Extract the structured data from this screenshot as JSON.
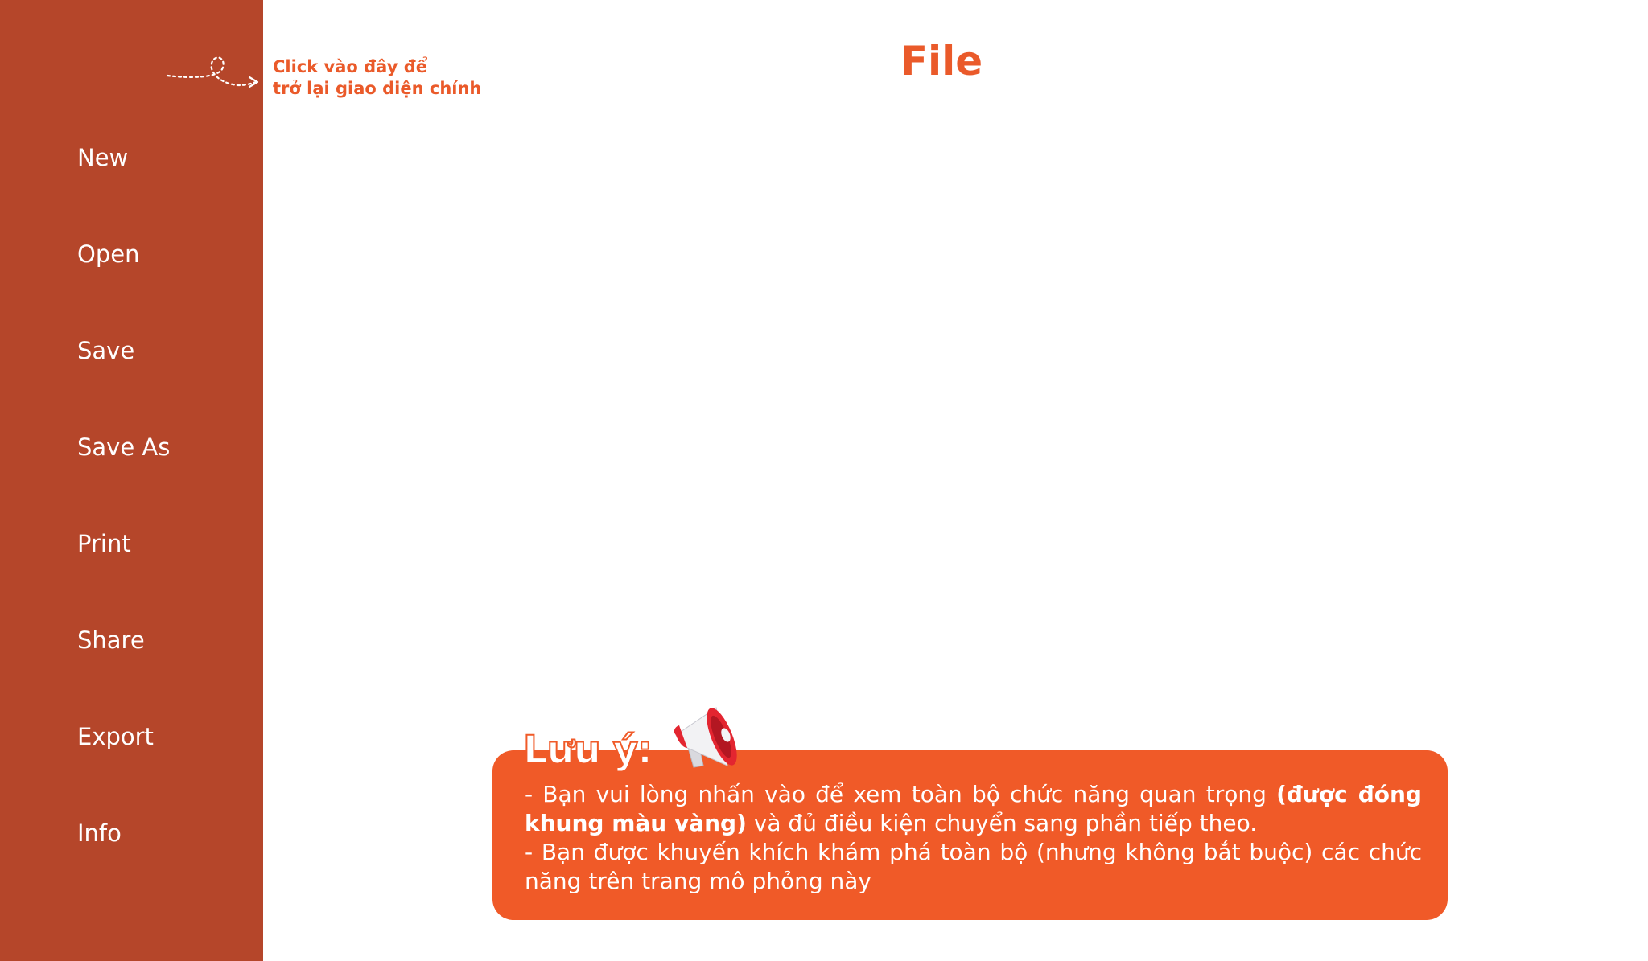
{
  "sidebar": {
    "items": [
      {
        "label": "New"
      },
      {
        "label": "Open"
      },
      {
        "label": "Save"
      },
      {
        "label": "Save As"
      },
      {
        "label": "Print"
      },
      {
        "label": "Share"
      },
      {
        "label": "Export"
      },
      {
        "label": "Info"
      }
    ]
  },
  "hint": {
    "line1": "Click vào đây để",
    "line2": "trở lại giao diện chính",
    "icon": "dashed-curved-arrow-icon"
  },
  "page": {
    "title": "File"
  },
  "note": {
    "heading": "Lưu ý:",
    "icon": "megaphone-icon",
    "line1_a": "- Bạn vui lòng nhấn vào để xem toàn bộ chức năng quan trọng ",
    "line1_bold": "(được đóng khung màu vàng)",
    "line1_b": " và đủ điều kiện chuyển sang phần tiếp theo.",
    "line2": "- Bạn được khuyến khích khám phá toàn bộ (nhưng không bắt buộc) các chức năng trên trang mô phỏng này"
  },
  "colors": {
    "sidebar": "#b5462a",
    "accent": "#ea5a2a",
    "note_box": "#f05a28"
  }
}
